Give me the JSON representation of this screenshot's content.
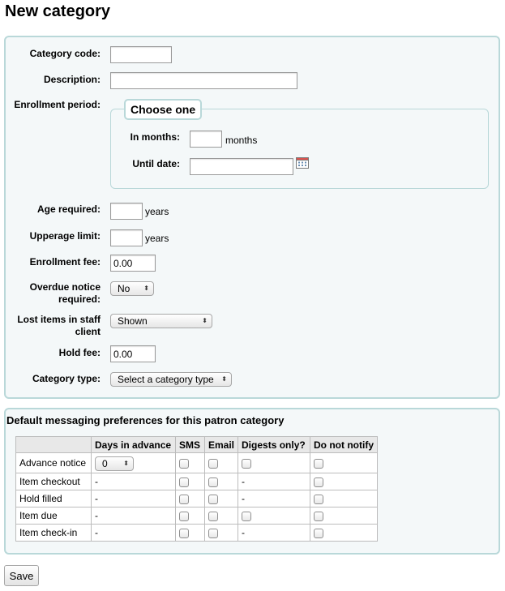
{
  "page_title": "New category",
  "form": {
    "category_code": {
      "label": "Category code:",
      "value": ""
    },
    "description": {
      "label": "Description:",
      "value": ""
    },
    "enrollment_period": {
      "label": "Enrollment period:",
      "legend": "Choose one",
      "in_months": {
        "label": "In months:",
        "value": "",
        "unit": "months"
      },
      "until_date": {
        "label": "Until date:",
        "value": "",
        "icon": "calendar-icon"
      }
    },
    "age_required": {
      "label": "Age required:",
      "value": "",
      "unit": "years"
    },
    "upperage_limit": {
      "label": "Upperage limit:",
      "value": "",
      "unit": "years"
    },
    "enrollment_fee": {
      "label": "Enrollment fee:",
      "value": "0.00"
    },
    "overdue_notice": {
      "label_line1": "Overdue notice",
      "label_line2": "required:",
      "selected": "No"
    },
    "lost_items": {
      "label_line1": "Lost items in staff",
      "label_line2": "client",
      "selected": "Shown"
    },
    "hold_fee": {
      "label": "Hold fee:",
      "value": "0.00"
    },
    "category_type": {
      "label": "Category type:",
      "selected": "Select a category type"
    }
  },
  "messaging": {
    "title": "Default messaging preferences for this patron category",
    "columns": [
      "",
      "Days in advance",
      "SMS",
      "Email",
      "Digests only?",
      "Do not notify"
    ],
    "rows": [
      {
        "name": "Advance notice",
        "days": "0",
        "days_is_select": true,
        "digest_checkbox": true
      },
      {
        "name": "Item checkout",
        "days": "-",
        "days_is_select": false,
        "digest_checkbox": false,
        "digest_text": "-"
      },
      {
        "name": "Hold filled",
        "days": "-",
        "days_is_select": false,
        "digest_checkbox": false,
        "digest_text": "-"
      },
      {
        "name": "Item due",
        "days": "-",
        "days_is_select": false,
        "digest_checkbox": true
      },
      {
        "name": "Item check-in",
        "days": "-",
        "days_is_select": false,
        "digest_checkbox": false,
        "digest_text": "-"
      }
    ]
  },
  "save_label": "Save",
  "colors": {
    "border": "#b9d8d9",
    "panel_bg": "#f4f8f9",
    "header_bg": "#e8e8e8"
  }
}
